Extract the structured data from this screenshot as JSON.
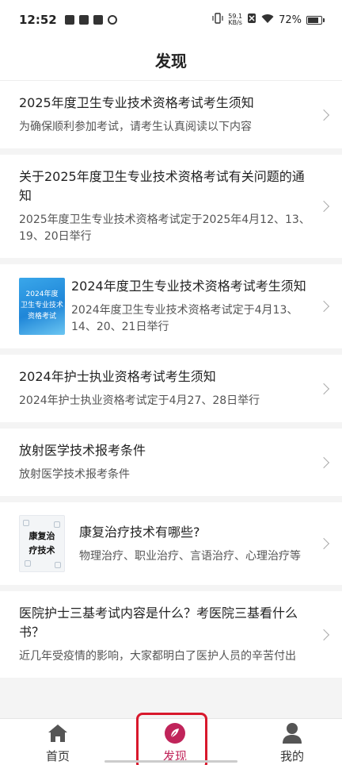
{
  "status_bar": {
    "time": "12:52",
    "net_speed_value": "59.1",
    "net_speed_unit": "KB/s",
    "battery_percent": "72%",
    "battery_level": 0.72,
    "icons_left": [
      "notification-icon",
      "app-icon",
      "app-icon",
      "app-icon"
    ],
    "icons_right": [
      "vibrate-icon",
      "no-sim-icon",
      "wifi-icon",
      "battery-icon"
    ]
  },
  "header": {
    "title": "发现"
  },
  "articles": [
    {
      "title": "2025年度卫生专业技术资格考试考生须知",
      "desc": "为确保顺利参加考试，请考生认真阅读以下内容"
    },
    {
      "title": "关于2025年度卫生专业技术资格考试有关问题的通知",
      "desc": "2025年度卫生专业技术资格考试定于2025年4月12、13、19、20日举行"
    },
    {
      "title": "2024年度卫生专业技术资格考试考生须知",
      "desc": "2024年度卫生专业技术资格考试定于4月13、14、20、21日举行",
      "thumb_lines": [
        "2024年度",
        "卫生专业技术",
        "资格考试"
      ]
    },
    {
      "title": "2024年护士执业资格考试考生须知",
      "desc": "2024年护士执业资格考试定于4月27、28日举行"
    },
    {
      "title": "放射医学技术报考条件",
      "desc": "放射医学技术报考条件"
    },
    {
      "title": "康复治疗技术有哪些?",
      "desc": "物理治疗、职业治疗、言语治疗、心理治疗等",
      "thumb_lines": [
        "康复治",
        "疗技术"
      ]
    },
    {
      "title": "医院护士三基考试内容是什么？考医院三基看什么书？",
      "desc": "近几年受疫情的影响，大家都明白了医护人员的辛苦付出"
    }
  ],
  "tabbar": {
    "tabs": [
      {
        "label": "首页",
        "icon": "home-icon"
      },
      {
        "label": "发现",
        "icon": "discover-icon",
        "active": true
      },
      {
        "label": "我的",
        "icon": "profile-icon"
      }
    ],
    "accent_color": "#c0245a",
    "highlight_color": "#d8182c"
  }
}
